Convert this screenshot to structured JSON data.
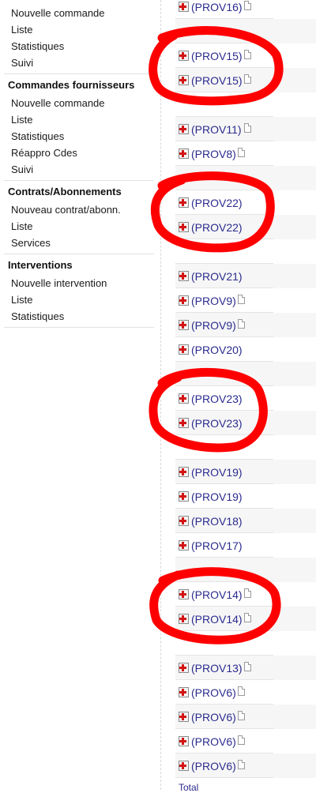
{
  "sidebar": {
    "group_orders_customers": {
      "items": [
        "Nouvelle commande",
        "Liste",
        "Statistiques",
        "Suivi"
      ]
    },
    "group_supplier_orders": {
      "title": "Commandes fournisseurs",
      "items": [
        "Nouvelle commande",
        "Liste",
        "Statistiques",
        "Réappro Cdes",
        "Suivi"
      ]
    },
    "group_contracts": {
      "title": "Contrats/Abonnements",
      "items": [
        "Nouveau contrat/abonn.",
        "Liste",
        "Services"
      ]
    },
    "group_interventions": {
      "title": "Interventions",
      "items": [
        "Nouvelle intervention",
        "Liste",
        "Statistiques"
      ]
    }
  },
  "ref_list": {
    "rows": [
      {
        "ref": "(PROV16)",
        "has_doc": true
      },
      {
        "ref": "",
        "has_doc": false
      },
      {
        "ref": "(PROV15)",
        "has_doc": true
      },
      {
        "ref": "(PROV15)",
        "has_doc": true
      },
      {
        "ref": "",
        "has_doc": false
      },
      {
        "ref": "(PROV11)",
        "has_doc": true
      },
      {
        "ref": "(PROV8)",
        "has_doc": true
      },
      {
        "ref": "",
        "has_doc": false
      },
      {
        "ref": "(PROV22)",
        "has_doc": false
      },
      {
        "ref": "(PROV22)",
        "has_doc": false
      },
      {
        "ref": "",
        "has_doc": false
      },
      {
        "ref": "(PROV21)",
        "has_doc": false
      },
      {
        "ref": "(PROV9)",
        "has_doc": true
      },
      {
        "ref": "(PROV9)",
        "has_doc": true
      },
      {
        "ref": "(PROV20)",
        "has_doc": false
      },
      {
        "ref": "",
        "has_doc": false
      },
      {
        "ref": "(PROV23)",
        "has_doc": false
      },
      {
        "ref": "(PROV23)",
        "has_doc": false
      },
      {
        "ref": "",
        "has_doc": false
      },
      {
        "ref": "(PROV19)",
        "has_doc": false
      },
      {
        "ref": "(PROV19)",
        "has_doc": false
      },
      {
        "ref": "(PROV18)",
        "has_doc": false
      },
      {
        "ref": "(PROV17)",
        "has_doc": false
      },
      {
        "ref": "",
        "has_doc": false
      },
      {
        "ref": "(PROV14)",
        "has_doc": true
      },
      {
        "ref": "(PROV14)",
        "has_doc": true
      },
      {
        "ref": "",
        "has_doc": false
      },
      {
        "ref": "(PROV13)",
        "has_doc": true
      },
      {
        "ref": "(PROV6)",
        "has_doc": true
      },
      {
        "ref": "(PROV6)",
        "has_doc": true
      },
      {
        "ref": "(PROV6)",
        "has_doc": true
      },
      {
        "ref": "(PROV6)",
        "has_doc": true
      }
    ],
    "total_label": "Total"
  },
  "annotation_color": "#ff0000"
}
